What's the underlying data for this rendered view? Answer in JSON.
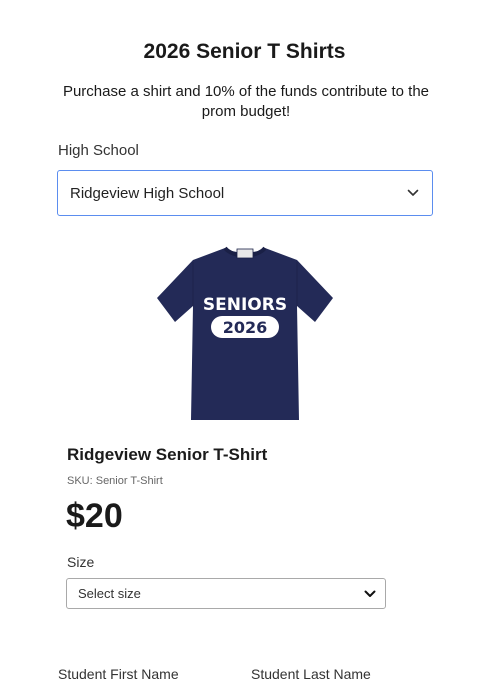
{
  "page": {
    "title": "2026 Senior T Shirts",
    "intro": "Purchase a shirt and 10% of the funds contribute to the prom budget!"
  },
  "school": {
    "label": "High School",
    "selected": "Ridgeview High School"
  },
  "product": {
    "image_icon": "navy-tshirt-image",
    "shirt_text": "SENIORS",
    "shirt_year": "2026",
    "name": "Ridgeview Senior T-Shirt",
    "sku": "SKU: Senior T-Shirt",
    "price": "$20"
  },
  "size": {
    "label": "Size",
    "placeholder": "Select size"
  },
  "student": {
    "first_name_label": "Student First Name",
    "last_name_label": "Student Last Name"
  },
  "colors": {
    "focus_border": "#5b8def",
    "shirt_navy": "#232a57"
  }
}
